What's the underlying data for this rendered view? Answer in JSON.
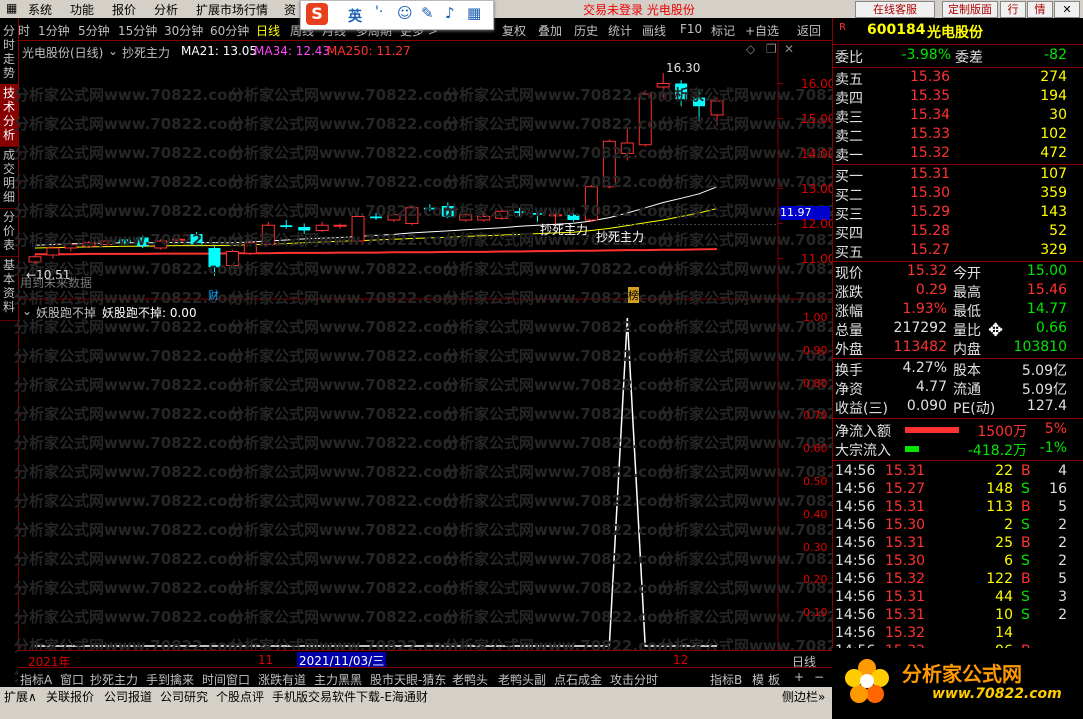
{
  "menu": {
    "items": [
      "系统",
      "功能",
      "报价",
      "分析",
      "扩展市场行情",
      "资"
    ],
    "notice": "交易未登录  光电股份",
    "right_buttons": [
      "在线客服",
      "定制版面",
      "行",
      "情"
    ]
  },
  "ime": {
    "logo": "S",
    "items": [
      "英"
    ]
  },
  "periods": {
    "items": [
      "分时",
      "1分钟",
      "5分钟",
      "15分钟",
      "30分钟",
      "60分钟",
      "日线",
      "周线",
      "月线",
      "多周期",
      "更多 >"
    ],
    "active_index": 6,
    "right_items": [
      "复权",
      "叠加",
      "历史",
      "统计",
      "画线",
      "F10",
      "标记",
      "+自选",
      "返回"
    ]
  },
  "vtabs": [
    {
      "label": "分时走势",
      "active": false
    },
    {
      "label": "技术分析",
      "active": true
    },
    {
      "label": "成交明细",
      "active": false
    },
    {
      "label": "分价表",
      "active": false
    },
    {
      "label": "基本资料",
      "active": false
    }
  ],
  "main_chart": {
    "header": {
      "title": "光电股份(日线)",
      "indicator": "抄死主力",
      "ma21_label": "MA21: 13.05",
      "ma34_label": "MA34: 12.43",
      "ma250_label": "MA250: 11.27"
    },
    "high_label": "16.30",
    "low_label": "←10.51",
    "future_note": "用到未来数据",
    "signal_label": "抄死主力",
    "price_tag": "11.97",
    "event_marks": [
      "财",
      "榜"
    ],
    "colors": {
      "up": "#ff3232",
      "down": "#00ffff",
      "ma21": "#ffffff",
      "ma34": "#ffff00",
      "ma250": "#ff3232"
    }
  },
  "sub_chart": {
    "header_name": "妖股跑不掉",
    "header_value": "妖股跑不掉: 0.00"
  },
  "watermark": "分析家公式网www.70822.com",
  "time_axis": {
    "year": "2021年",
    "month11": "11",
    "current": "2021/11/03/三",
    "month12": "12",
    "period": "日线"
  },
  "chart_data": [
    {
      "type": "candlestick",
      "title": "光电股份(日线)",
      "ylim": [
        10.5,
        16.5
      ],
      "y_ticks": [
        11.0,
        12.0,
        13.0,
        14.0,
        15.0,
        16.0
      ],
      "candles": [
        {
          "o": 10.9,
          "h": 11.1,
          "l": 10.8,
          "c": 11.05
        },
        {
          "o": 11.1,
          "h": 11.35,
          "l": 11.0,
          "c": 11.3
        },
        {
          "o": 11.3,
          "h": 11.45,
          "l": 11.2,
          "c": 11.4
        },
        {
          "o": 11.35,
          "h": 11.5,
          "l": 11.3,
          "c": 11.45
        },
        {
          "o": 11.4,
          "h": 11.55,
          "l": 11.35,
          "c": 11.5
        },
        {
          "o": 11.55,
          "h": 11.6,
          "l": 11.4,
          "c": 11.45
        },
        {
          "o": 11.6,
          "h": 11.65,
          "l": 11.3,
          "c": 11.35
        },
        {
          "o": 11.3,
          "h": 11.55,
          "l": 11.25,
          "c": 11.5
        },
        {
          "o": 11.55,
          "h": 11.7,
          "l": 11.45,
          "c": 11.55
        },
        {
          "o": 11.7,
          "h": 11.75,
          "l": 11.35,
          "c": 11.4
        },
        {
          "o": 11.3,
          "h": 11.35,
          "l": 10.51,
          "c": 10.75
        },
        {
          "o": 10.8,
          "h": 11.25,
          "l": 10.75,
          "c": 11.2
        },
        {
          "o": 11.15,
          "h": 11.5,
          "l": 11.1,
          "c": 11.45
        },
        {
          "o": 11.4,
          "h": 12.05,
          "l": 11.4,
          "c": 11.95
        },
        {
          "o": 11.95,
          "h": 12.1,
          "l": 11.85,
          "c": 11.9
        },
        {
          "o": 11.9,
          "h": 12.0,
          "l": 11.7,
          "c": 11.8
        },
        {
          "o": 11.8,
          "h": 12.05,
          "l": 11.75,
          "c": 11.95
        },
        {
          "o": 11.95,
          "h": 12.0,
          "l": 11.85,
          "c": 11.95
        },
        {
          "o": 11.5,
          "h": 12.3,
          "l": 11.45,
          "c": 12.2
        },
        {
          "o": 12.2,
          "h": 12.3,
          "l": 12.1,
          "c": 12.15
        },
        {
          "o": 12.1,
          "h": 12.3,
          "l": 12.05,
          "c": 12.25
        },
        {
          "o": 12.0,
          "h": 12.5,
          "l": 11.95,
          "c": 12.45
        },
        {
          "o": 12.45,
          "h": 12.55,
          "l": 12.35,
          "c": 12.4
        },
        {
          "o": 12.5,
          "h": 12.6,
          "l": 12.15,
          "c": 12.2
        },
        {
          "o": 12.1,
          "h": 12.3,
          "l": 12.05,
          "c": 12.25
        },
        {
          "o": 12.1,
          "h": 12.3,
          "l": 12.05,
          "c": 12.2
        },
        {
          "o": 12.15,
          "h": 12.4,
          "l": 12.1,
          "c": 12.35
        },
        {
          "o": 12.35,
          "h": 12.45,
          "l": 12.2,
          "c": 12.3
        },
        {
          "o": 12.3,
          "h": 12.35,
          "l": 12.05,
          "c": 12.25
        },
        {
          "o": 12.25,
          "h": 12.3,
          "l": 11.95,
          "c": 12.25
        },
        {
          "o": 12.25,
          "h": 12.3,
          "l": 12.05,
          "c": 12.1
        },
        {
          "o": 12.1,
          "h": 13.1,
          "l": 12.05,
          "c": 13.05
        },
        {
          "o": 13.05,
          "h": 14.4,
          "l": 13.0,
          "c": 14.35
        },
        {
          "o": 14.0,
          "h": 14.7,
          "l": 13.8,
          "c": 14.3
        },
        {
          "o": 14.25,
          "h": 15.8,
          "l": 14.2,
          "c": 15.7
        },
        {
          "o": 15.9,
          "h": 16.3,
          "l": 15.6,
          "c": 16.0
        },
        {
          "o": 16.0,
          "h": 16.1,
          "l": 15.35,
          "c": 15.55
        },
        {
          "o": 15.6,
          "h": 15.8,
          "l": 14.9,
          "c": 15.35
        },
        {
          "o": 15.1,
          "h": 15.6,
          "l": 14.8,
          "c": 15.5
        }
      ],
      "series": [
        {
          "name": "MA21",
          "values": [
            11.38,
            11.4,
            11.42,
            11.43,
            11.44,
            11.45,
            11.45,
            11.45,
            11.46,
            11.46,
            11.45,
            11.45,
            11.47,
            11.5,
            11.53,
            11.56,
            11.58,
            11.6,
            11.63,
            11.66,
            11.69,
            11.73,
            11.76,
            11.79,
            11.82,
            11.85,
            11.88,
            11.92,
            11.95,
            11.98,
            12.01,
            12.07,
            12.17,
            12.3,
            12.45,
            12.6,
            12.72,
            12.85,
            13.05
          ]
        },
        {
          "name": "MA34",
          "values": [
            11.3,
            11.31,
            11.32,
            11.33,
            11.34,
            11.35,
            11.35,
            11.36,
            11.37,
            11.37,
            11.37,
            11.38,
            11.39,
            11.41,
            11.43,
            11.45,
            11.47,
            11.49,
            11.51,
            11.53,
            11.55,
            11.57,
            11.59,
            11.61,
            11.63,
            11.65,
            11.67,
            11.69,
            11.71,
            11.73,
            11.75,
            11.8,
            11.86,
            11.94,
            12.02,
            12.1,
            12.2,
            12.3,
            12.43
          ]
        },
        {
          "name": "MA250",
          "values": [
            11.12,
            11.12,
            11.12,
            11.13,
            11.13,
            11.13,
            11.13,
            11.14,
            11.14,
            11.14,
            11.14,
            11.15,
            11.15,
            11.15,
            11.16,
            11.16,
            11.16,
            11.17,
            11.17,
            11.17,
            11.18,
            11.18,
            11.18,
            11.19,
            11.19,
            11.19,
            11.2,
            11.2,
            11.21,
            11.21,
            11.22,
            11.22,
            11.23,
            11.24,
            11.24,
            11.25,
            11.25,
            11.26,
            11.27
          ]
        }
      ]
    },
    {
      "type": "line",
      "title": "妖股跑不掉",
      "ylim": [
        0,
        1.0
      ],
      "y_ticks": [
        1.0,
        0.9,
        0.8,
        0.7,
        0.6,
        0.5,
        0.4,
        0.3,
        0.2,
        0.1
      ],
      "series": [
        {
          "name": "妖股跑不掉",
          "values": [
            0,
            0,
            0,
            0,
            0,
            0,
            0,
            0,
            0,
            0,
            0,
            0,
            0,
            0,
            0,
            0,
            0,
            0,
            0,
            0,
            0,
            0,
            0,
            0,
            0,
            0,
            0,
            0,
            0,
            0,
            0,
            0,
            0,
            1,
            0,
            0,
            0,
            0,
            0
          ]
        }
      ]
    }
  ],
  "quote": {
    "code": "600184",
    "name": "光电股份",
    "marker": "R",
    "weibi_label": "委比",
    "weibi": "-3.98%",
    "weicha_label": "委差",
    "weicha": "-82",
    "asks": [
      {
        "label": "卖五",
        "price": "15.36",
        "vol": "274"
      },
      {
        "label": "卖四",
        "price": "15.35",
        "vol": "194"
      },
      {
        "label": "卖三",
        "price": "15.34",
        "vol": "30"
      },
      {
        "label": "卖二",
        "price": "15.33",
        "vol": "102"
      },
      {
        "label": "卖一",
        "price": "15.32",
        "vol": "472"
      }
    ],
    "bids": [
      {
        "label": "买一",
        "price": "15.31",
        "vol": "107"
      },
      {
        "label": "买二",
        "price": "15.30",
        "vol": "359"
      },
      {
        "label": "买三",
        "price": "15.29",
        "vol": "143"
      },
      {
        "label": "买四",
        "price": "15.28",
        "vol": "52"
      },
      {
        "label": "买五",
        "price": "15.27",
        "vol": "329"
      }
    ],
    "stats": [
      {
        "l1": "现价",
        "v1": "15.32",
        "c1": "red",
        "l2": "今开",
        "v2": "15.00",
        "c2": "green"
      },
      {
        "l1": "涨跌",
        "v1": "0.29",
        "c1": "red",
        "l2": "最高",
        "v2": "15.46",
        "c2": "red"
      },
      {
        "l1": "涨幅",
        "v1": "1.93%",
        "c1": "red",
        "l2": "最低",
        "v2": "14.77",
        "c2": "green"
      },
      {
        "l1": "总量",
        "v1": "217292",
        "c1": "white",
        "l2": "量比",
        "v2": "0.66",
        "c2": "green"
      },
      {
        "l1": "外盘",
        "v1": "113482",
        "c1": "red",
        "l2": "内盘",
        "v2": "103810",
        "c2": "green"
      }
    ],
    "fund": [
      {
        "l1": "换手",
        "v1": "4.27%",
        "l2": "股本",
        "v2": "5.09亿"
      },
      {
        "l1": "净资",
        "v1": "4.77",
        "l2": "流通",
        "v2": "5.09亿"
      },
      {
        "l1": "收益(三)",
        "v1": "0.090",
        "l2": "PE(动)",
        "v2": "127.4"
      }
    ],
    "flows": [
      {
        "label": "净流入额",
        "value": "1500万",
        "pct": "5%",
        "color": "red"
      },
      {
        "label": "大宗流入",
        "value": "-418.2万",
        "pct": "-1%",
        "color": "green"
      }
    ],
    "ticks": [
      {
        "t": "14:56",
        "p": "15.31",
        "v": "22",
        "d": "B",
        "n": "4"
      },
      {
        "t": "14:56",
        "p": "15.27",
        "v": "148",
        "d": "S",
        "n": "16"
      },
      {
        "t": "14:56",
        "p": "15.31",
        "v": "113",
        "d": "B",
        "n": "5"
      },
      {
        "t": "14:56",
        "p": "15.30",
        "v": "2",
        "d": "S",
        "n": "2"
      },
      {
        "t": "14:56",
        "p": "15.31",
        "v": "25",
        "d": "B",
        "n": "2"
      },
      {
        "t": "14:56",
        "p": "15.30",
        "v": "6",
        "d": "S",
        "n": "2"
      },
      {
        "t": "14:56",
        "p": "15.32",
        "v": "122",
        "d": "B",
        "n": "5"
      },
      {
        "t": "14:56",
        "p": "15.31",
        "v": "44",
        "d": "S",
        "n": "3"
      },
      {
        "t": "14:56",
        "p": "15.31",
        "v": "10",
        "d": "S",
        "n": "2"
      },
      {
        "t": "14:56",
        "p": "15.32",
        "v": "14",
        "d": "",
        "n": ""
      },
      {
        "t": "14:56",
        "p": "15.32",
        "v": "96",
        "d": "B",
        "n": ""
      },
      {
        "t": "15:00",
        "p": "",
        "v": "",
        "d": "",
        "n": ""
      }
    ]
  },
  "tabs_bar": {
    "items": [
      "指标A",
      "窗口",
      "抄死主力",
      "手到擒来",
      "时间窗口",
      "涨跌有道",
      "主力黑黑",
      "股市天眼-猜东",
      "老鸭头",
      "老鸭头副",
      "点石成金",
      "攻击分时"
    ],
    "right_items": [
      "指标B",
      "模",
      "板"
    ]
  },
  "status_bar": {
    "items": [
      "扩展∧",
      "关联报价",
      "公司报道",
      "公司研究",
      "个股点评",
      "手机版交易软件下载-E海通财"
    ],
    "right": "侧边栏»",
    "right2": "笔"
  },
  "logo": {
    "text": "分析家公式网",
    "url": "www.70822.com"
  }
}
